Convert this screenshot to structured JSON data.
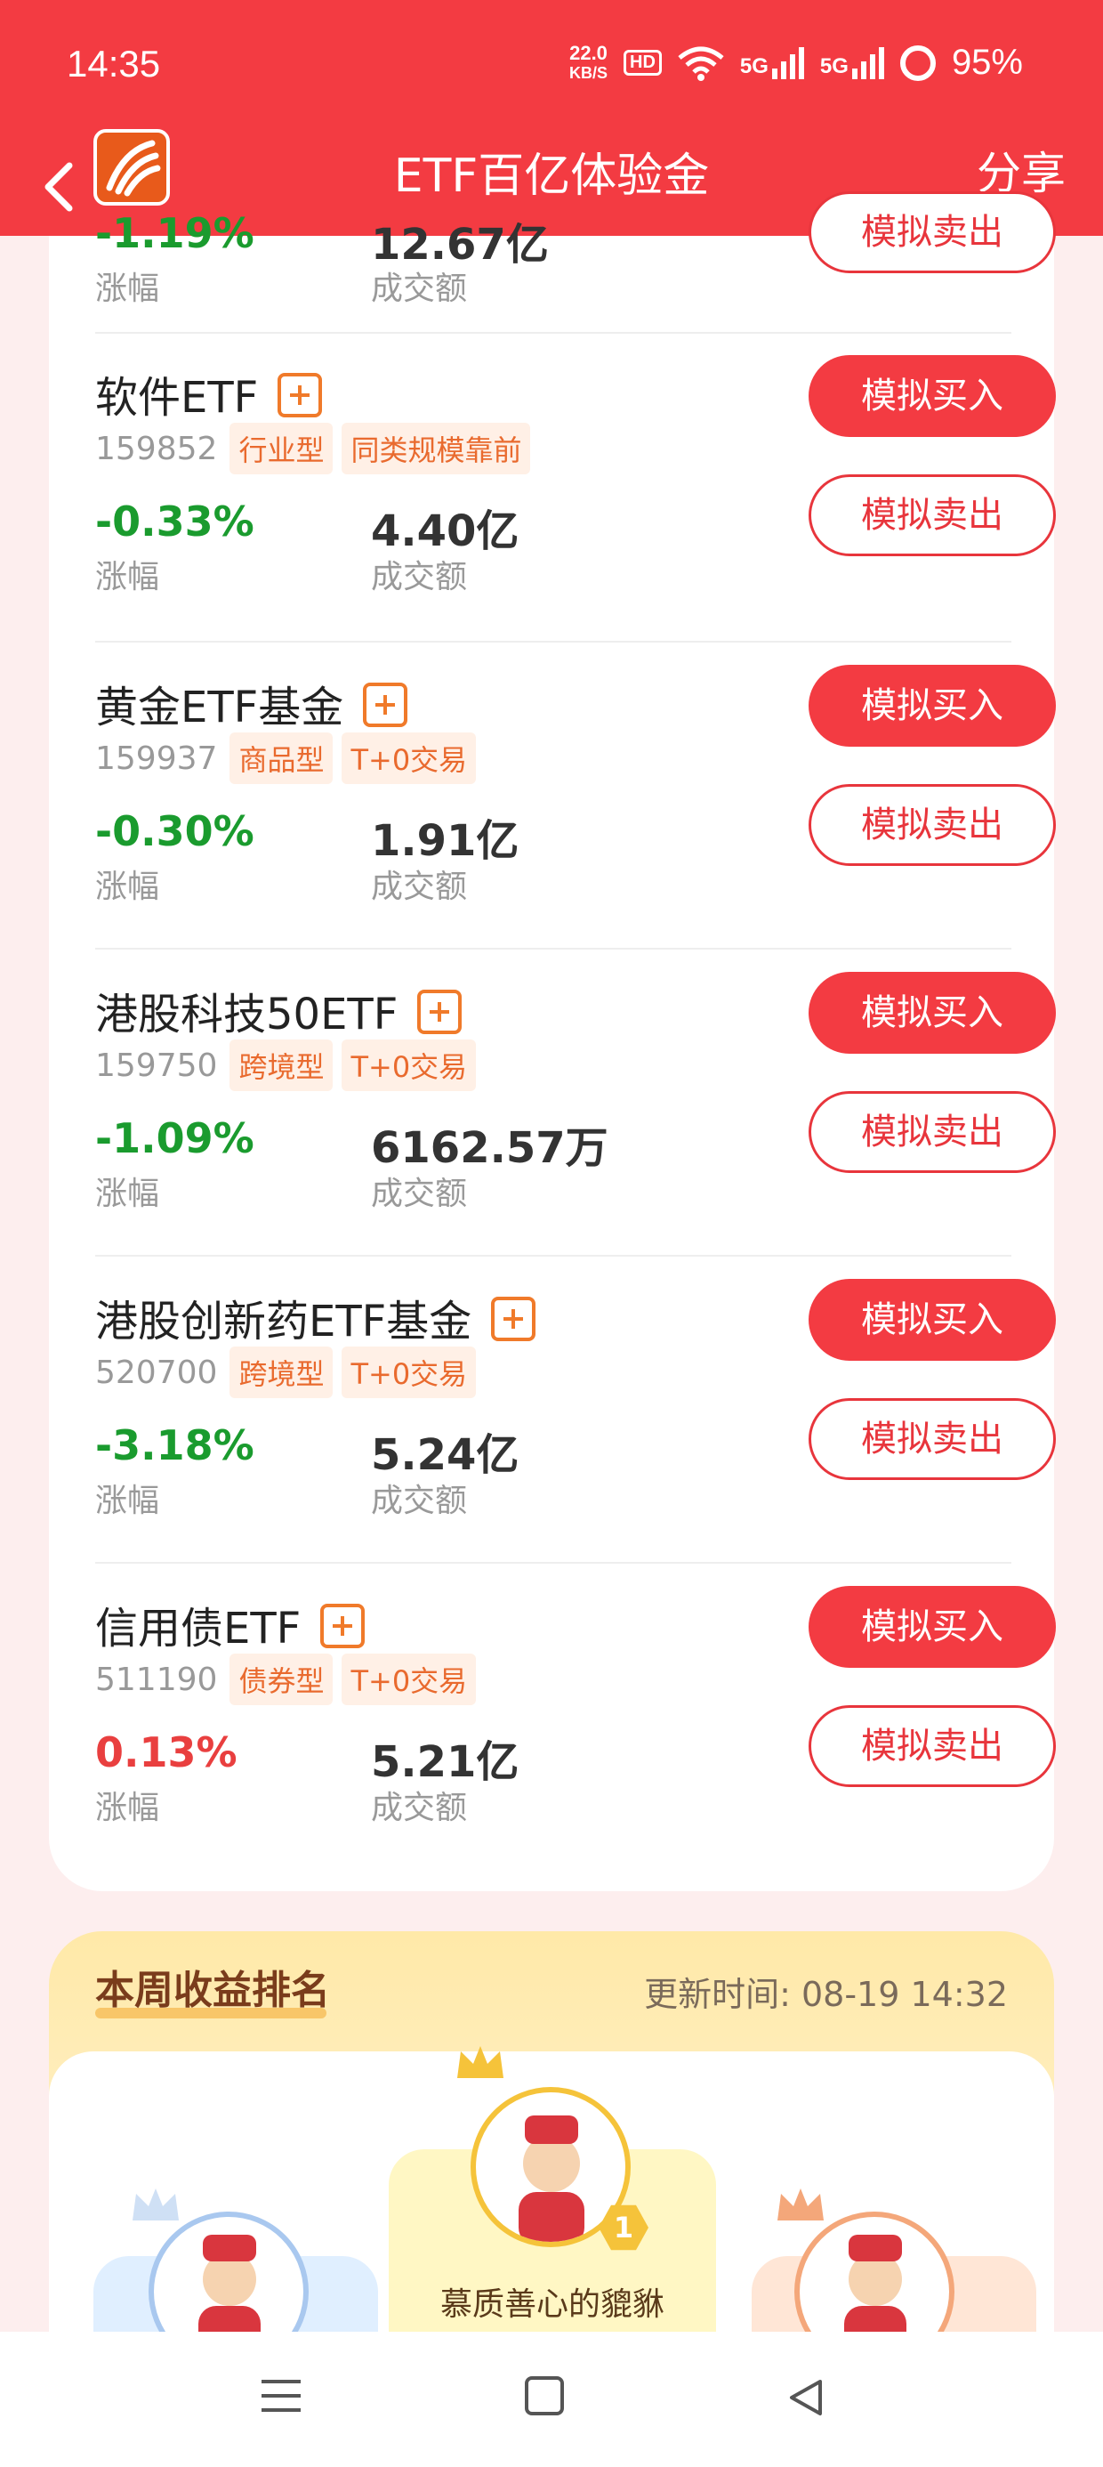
{
  "status_bar": {
    "time": "14:35",
    "net_speed_value": "22.0",
    "net_speed_unit": "KB/S",
    "hd_label": "HD",
    "signal_1": "5G",
    "signal_2": "5G",
    "battery": "95%"
  },
  "nav": {
    "title": "ETF百亿体验金",
    "share_label": "分享"
  },
  "labels": {
    "change": "涨幅",
    "volume": "成交额",
    "buy": "模拟买入",
    "sell": "模拟卖出"
  },
  "partial_fund": {
    "change": "-1.19%",
    "volume": "12.67亿"
  },
  "funds": [
    {
      "name": "软件ETF",
      "code": "159852",
      "tags": [
        "行业型",
        "同类规模靠前"
      ],
      "change": "-0.33%",
      "volume": "4.40亿",
      "direction": "down"
    },
    {
      "name": "黄金ETF基金",
      "code": "159937",
      "tags": [
        "商品型",
        "T+0交易"
      ],
      "change": "-0.30%",
      "volume": "1.91亿",
      "direction": "down"
    },
    {
      "name": "港股科技50ETF",
      "code": "159750",
      "tags": [
        "跨境型",
        "T+0交易"
      ],
      "change": "-1.09%",
      "volume": "6162.57万",
      "direction": "down"
    },
    {
      "name": "港股创新药ETF基金",
      "code": "520700",
      "tags": [
        "跨境型",
        "T+0交易"
      ],
      "change": "-3.18%",
      "volume": "5.24亿",
      "direction": "down"
    },
    {
      "name": "信用债ETF",
      "code": "511190",
      "tags": [
        "债券型",
        "T+0交易"
      ],
      "change": "0.13%",
      "volume": "5.21亿",
      "direction": "up"
    }
  ],
  "ranking": {
    "title": "本周收益排名",
    "update_time": "更新时间: 08-19 14:32",
    "first_badge": "1",
    "first_name": "慕质善心的貔貅"
  },
  "colors": {
    "brand_red": "#f33b42",
    "down_green": "#1a9b2e",
    "up_red": "#e93f3f",
    "tag_orange": "#e96a2e"
  }
}
